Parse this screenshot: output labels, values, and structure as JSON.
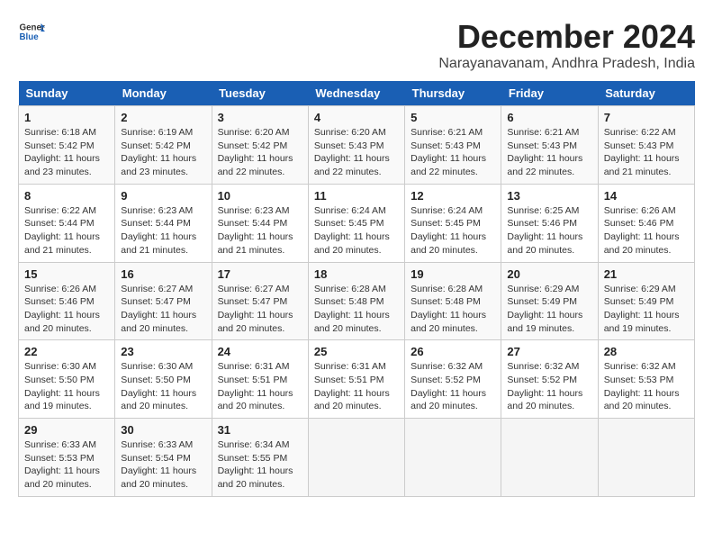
{
  "header": {
    "logo_line1": "General",
    "logo_line2": "Blue",
    "title": "December 2024",
    "subtitle": "Narayanavanam, Andhra Pradesh, India"
  },
  "days_of_week": [
    "Sunday",
    "Monday",
    "Tuesday",
    "Wednesday",
    "Thursday",
    "Friday",
    "Saturday"
  ],
  "weeks": [
    [
      {
        "day": "1",
        "sunrise": "6:18 AM",
        "sunset": "5:42 PM",
        "daylight": "11 hours and 23 minutes."
      },
      {
        "day": "2",
        "sunrise": "6:19 AM",
        "sunset": "5:42 PM",
        "daylight": "11 hours and 23 minutes."
      },
      {
        "day": "3",
        "sunrise": "6:20 AM",
        "sunset": "5:42 PM",
        "daylight": "11 hours and 22 minutes."
      },
      {
        "day": "4",
        "sunrise": "6:20 AM",
        "sunset": "5:43 PM",
        "daylight": "11 hours and 22 minutes."
      },
      {
        "day": "5",
        "sunrise": "6:21 AM",
        "sunset": "5:43 PM",
        "daylight": "11 hours and 22 minutes."
      },
      {
        "day": "6",
        "sunrise": "6:21 AM",
        "sunset": "5:43 PM",
        "daylight": "11 hours and 22 minutes."
      },
      {
        "day": "7",
        "sunrise": "6:22 AM",
        "sunset": "5:43 PM",
        "daylight": "11 hours and 21 minutes."
      }
    ],
    [
      {
        "day": "8",
        "sunrise": "6:22 AM",
        "sunset": "5:44 PM",
        "daylight": "11 hours and 21 minutes."
      },
      {
        "day": "9",
        "sunrise": "6:23 AM",
        "sunset": "5:44 PM",
        "daylight": "11 hours and 21 minutes."
      },
      {
        "day": "10",
        "sunrise": "6:23 AM",
        "sunset": "5:44 PM",
        "daylight": "11 hours and 21 minutes."
      },
      {
        "day": "11",
        "sunrise": "6:24 AM",
        "sunset": "5:45 PM",
        "daylight": "11 hours and 20 minutes."
      },
      {
        "day": "12",
        "sunrise": "6:24 AM",
        "sunset": "5:45 PM",
        "daylight": "11 hours and 20 minutes."
      },
      {
        "day": "13",
        "sunrise": "6:25 AM",
        "sunset": "5:46 PM",
        "daylight": "11 hours and 20 minutes."
      },
      {
        "day": "14",
        "sunrise": "6:26 AM",
        "sunset": "5:46 PM",
        "daylight": "11 hours and 20 minutes."
      }
    ],
    [
      {
        "day": "15",
        "sunrise": "6:26 AM",
        "sunset": "5:46 PM",
        "daylight": "11 hours and 20 minutes."
      },
      {
        "day": "16",
        "sunrise": "6:27 AM",
        "sunset": "5:47 PM",
        "daylight": "11 hours and 20 minutes."
      },
      {
        "day": "17",
        "sunrise": "6:27 AM",
        "sunset": "5:47 PM",
        "daylight": "11 hours and 20 minutes."
      },
      {
        "day": "18",
        "sunrise": "6:28 AM",
        "sunset": "5:48 PM",
        "daylight": "11 hours and 20 minutes."
      },
      {
        "day": "19",
        "sunrise": "6:28 AM",
        "sunset": "5:48 PM",
        "daylight": "11 hours and 20 minutes."
      },
      {
        "day": "20",
        "sunrise": "6:29 AM",
        "sunset": "5:49 PM",
        "daylight": "11 hours and 19 minutes."
      },
      {
        "day": "21",
        "sunrise": "6:29 AM",
        "sunset": "5:49 PM",
        "daylight": "11 hours and 19 minutes."
      }
    ],
    [
      {
        "day": "22",
        "sunrise": "6:30 AM",
        "sunset": "5:50 PM",
        "daylight": "11 hours and 19 minutes."
      },
      {
        "day": "23",
        "sunrise": "6:30 AM",
        "sunset": "5:50 PM",
        "daylight": "11 hours and 20 minutes."
      },
      {
        "day": "24",
        "sunrise": "6:31 AM",
        "sunset": "5:51 PM",
        "daylight": "11 hours and 20 minutes."
      },
      {
        "day": "25",
        "sunrise": "6:31 AM",
        "sunset": "5:51 PM",
        "daylight": "11 hours and 20 minutes."
      },
      {
        "day": "26",
        "sunrise": "6:32 AM",
        "sunset": "5:52 PM",
        "daylight": "11 hours and 20 minutes."
      },
      {
        "day": "27",
        "sunrise": "6:32 AM",
        "sunset": "5:52 PM",
        "daylight": "11 hours and 20 minutes."
      },
      {
        "day": "28",
        "sunrise": "6:32 AM",
        "sunset": "5:53 PM",
        "daylight": "11 hours and 20 minutes."
      }
    ],
    [
      {
        "day": "29",
        "sunrise": "6:33 AM",
        "sunset": "5:53 PM",
        "daylight": "11 hours and 20 minutes."
      },
      {
        "day": "30",
        "sunrise": "6:33 AM",
        "sunset": "5:54 PM",
        "daylight": "11 hours and 20 minutes."
      },
      {
        "day": "31",
        "sunrise": "6:34 AM",
        "sunset": "5:55 PM",
        "daylight": "11 hours and 20 minutes."
      },
      null,
      null,
      null,
      null
    ]
  ],
  "labels": {
    "sunrise": "Sunrise:",
    "sunset": "Sunset:",
    "daylight": "Daylight:"
  }
}
